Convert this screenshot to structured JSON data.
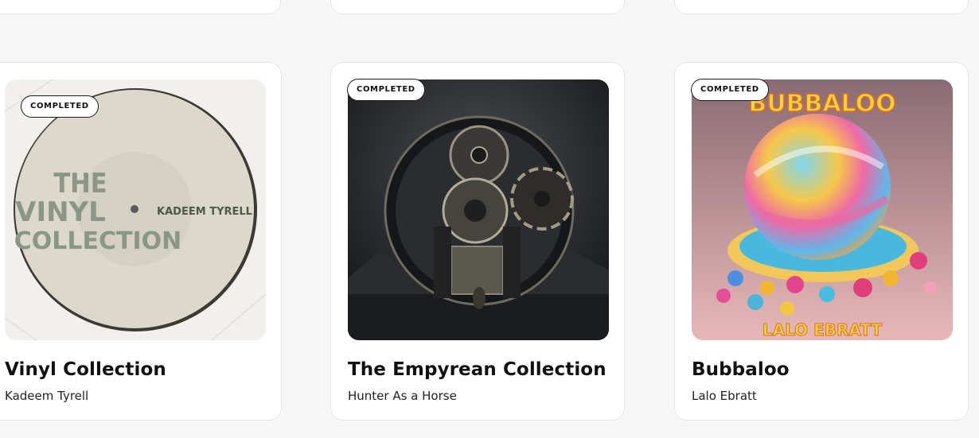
{
  "cards": [
    {
      "badge": "COMPLETED",
      "title": "Vinyl Collection",
      "artist": "Kadeem Tyrell",
      "cover": {
        "icon": "vinyl-record-art",
        "text_lines": [
          "THE",
          "VINYL",
          "COLLECTION"
        ],
        "label_text": "KADEEM TYRELL"
      }
    },
    {
      "badge": "COMPLETED",
      "title": "The Empyrean Collection",
      "artist": "Hunter As a Horse",
      "cover": {
        "icon": "reel-to-reel-art"
      }
    },
    {
      "badge": "COMPLETED",
      "title": "Bubbaloo",
      "artist": "Lalo Ebratt",
      "cover": {
        "icon": "candy-sphere-art",
        "top_text": "BUBBALOO",
        "bottom_text": "LALO EBRATT"
      }
    }
  ],
  "colors": {
    "page_bg": "#f7f7f7",
    "card_bg": "#ffffff",
    "card_border": "#e6e6e6",
    "badge_border": "#1a1a1a",
    "text": "#111111"
  }
}
